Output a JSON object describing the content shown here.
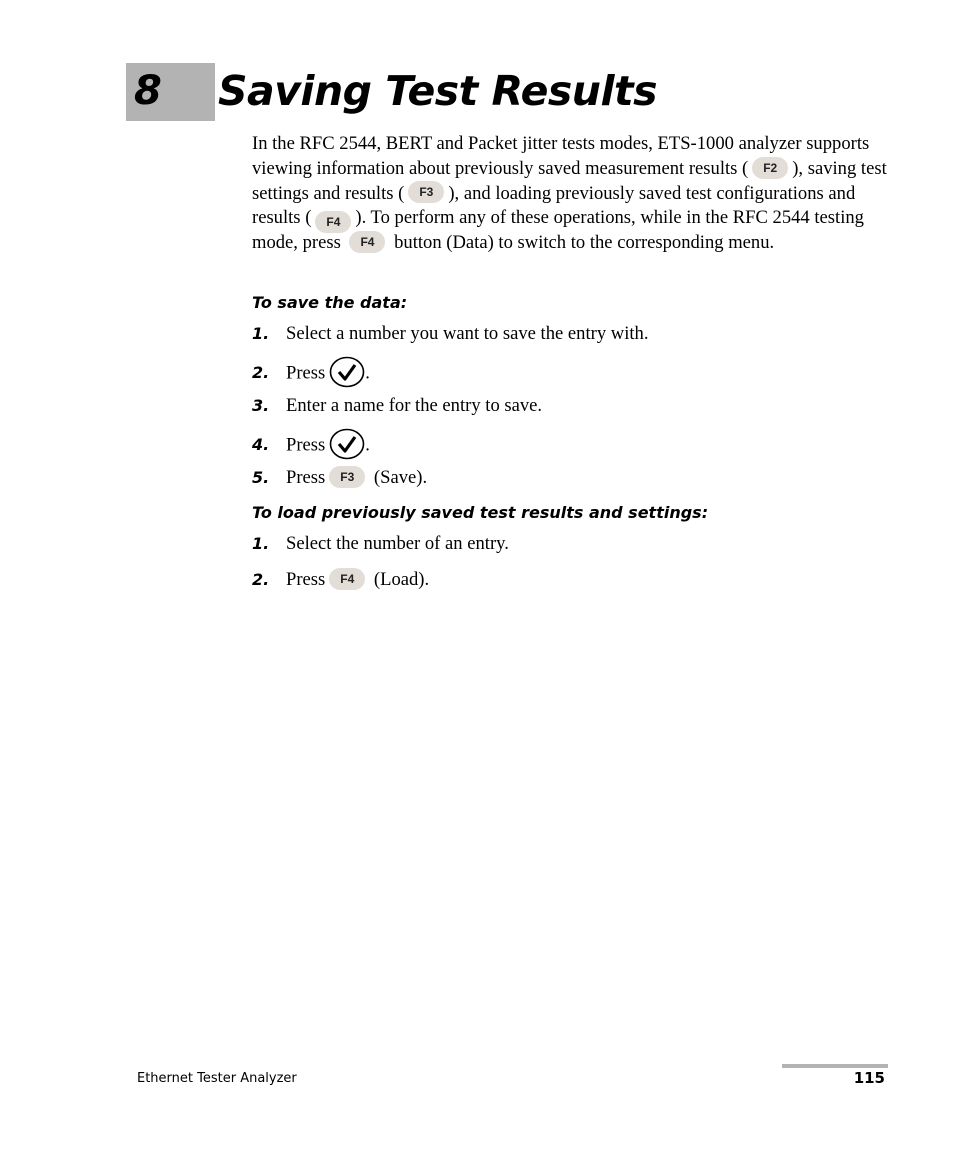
{
  "chapter": {
    "number": "8",
    "title": "Saving Test Results"
  },
  "intro": {
    "s1": "In the RFC 2544, BERT and Packet jitter tests modes, ETS-1000 analyzer supports viewing information about previously saved measurement results (",
    "k1": "F2",
    "s2": "), saving test settings and results (",
    "k2": "F3",
    "s3": "), and loading previously saved test configurations and results (",
    "k3": "F4",
    "s4": "). To perform any of these operations, while in the RFC 2544 testing mode, press",
    "k4": "F4",
    "s5": "button (Data) to switch to the corresponding menu."
  },
  "save_section": {
    "heading": "To save the data:",
    "steps": [
      {
        "num": "1.",
        "text": "Select a number you want to save the entry with."
      },
      {
        "num": "2.",
        "text": "Press",
        "icon": "checkmark-button",
        "after": "."
      },
      {
        "num": "3.",
        "text": "Enter a name for the entry to save."
      },
      {
        "num": "4.",
        "text": "Press",
        "icon": "checkmark-button",
        "after": "."
      },
      {
        "num": "5.",
        "text": "Press",
        "key": "F3",
        "after": "(Save)."
      }
    ]
  },
  "load_section": {
    "heading": "To load previously saved test results and settings:",
    "steps": [
      {
        "num": "1.",
        "text": "Select the number of an entry."
      },
      {
        "num": "2.",
        "text": "Press",
        "key": "F4",
        "after": "(Load)."
      }
    ]
  },
  "footer": {
    "title": "Ethernet Tester Analyzer",
    "page": "115"
  }
}
